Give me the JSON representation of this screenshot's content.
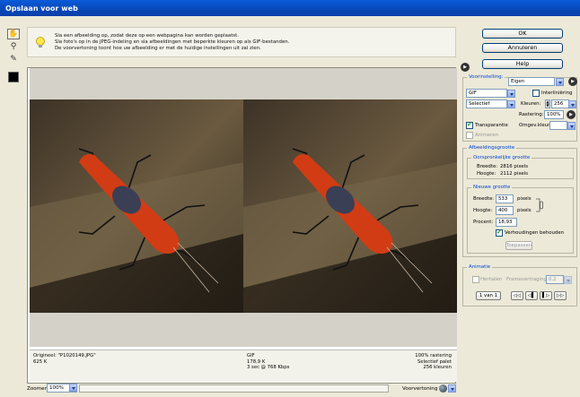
{
  "window": {
    "title": "Opslaan voor web"
  },
  "hint": {
    "lines": [
      "Sla een afbeelding op, zodat deze op een webpagina kan worden geplaatst.",
      "Sla foto's op in de JPEG-indeling en sla afbeeldingen met beperkte kleuren op als GIF-bestanden.",
      "De voorvertoning toont hoe uw afbeelding er met de huidige instellingen uit zal zien."
    ]
  },
  "buttons": {
    "ok": "OK",
    "cancel": "Annuleren",
    "help": "Help"
  },
  "settings": {
    "preset_label": "Voorinstelling:",
    "preset_value": "Eigen",
    "format": "GIF",
    "palette": "Selectief",
    "interlace_label": "Interliniëring",
    "colors_label": "Kleuren:",
    "colors_value": "256",
    "dither_label": "Rastering:",
    "dither_value": "100%",
    "transparency_label": "Transparantie",
    "matte_label": "Omgev.kleur:",
    "animate_label": "Animeren"
  },
  "image_size": {
    "title": "Afbeeldingsgrootte",
    "original_title": "Oorspronkelijke grootte",
    "orig_width_label": "Breedte:",
    "orig_width": "2816 pixels",
    "orig_height_label": "Hoogte:",
    "orig_height": "2112 pixels",
    "new_title": "Nieuwe grootte",
    "width_label": "Breedte:",
    "width_value": "533",
    "width_unit": "pixels",
    "height_label": "Hoogte:",
    "height_value": "400",
    "height_unit": "pixels",
    "percent_label": "Procent:",
    "percent_value": "18,93",
    "constrain_label": "Verhoudingen behouden",
    "apply_label": "Toepassen"
  },
  "animation": {
    "title": "Animatie",
    "loop_label": "Herhalen",
    "frame_delay_label": "Framevertraging:",
    "frame_delay_value": "0,2",
    "frame_counter": "1 van 1",
    "nav": [
      "◁◁",
      "◁▌",
      "▌▷",
      "▷▷"
    ]
  },
  "preview": {
    "left": {
      "line1": "Origineel: \"P1020149.JPG\"",
      "line2": "625 K"
    },
    "right": {
      "line1": "GIF",
      "line2": "178,9 K",
      "line3": "3 sec @ 768 Kbps",
      "r1": "100% rastering",
      "r2": "Selectief palet",
      "r3": "256 kleuren"
    }
  },
  "status": {
    "zoom_label": "Zoomen:",
    "zoom_value": "100%",
    "preview_in_label": "Voorvertoning in:"
  },
  "colors": {
    "title_bar": "#0a4fc8",
    "insect": "#d13c15",
    "wood": "#5c4a33",
    "gray": "#d4d2c8"
  }
}
